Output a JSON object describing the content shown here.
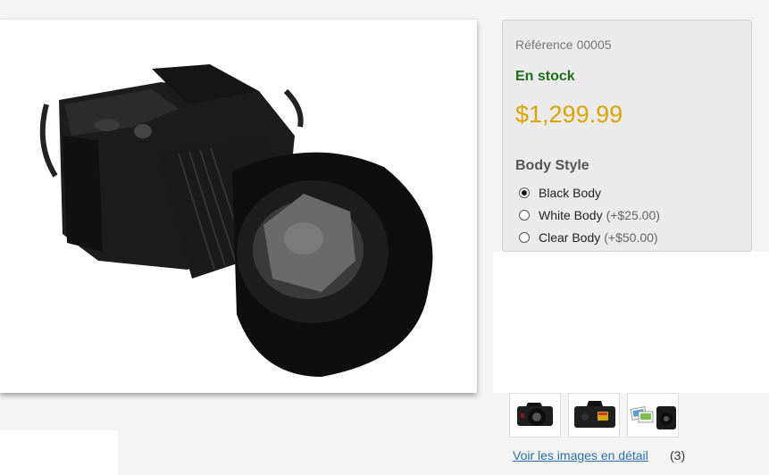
{
  "product": {
    "reference_label": "Référence",
    "reference_value": "00005",
    "stock_status": "En stock",
    "price": "$1,299.99",
    "image_alt": "DSLR camera with lens hood"
  },
  "options": {
    "title": "Body Style",
    "items": [
      {
        "label": "Black Body",
        "surcharge": "",
        "selected": true
      },
      {
        "label": "White Body",
        "surcharge": "(+$25.00)",
        "selected": false
      },
      {
        "label": "Clear Body",
        "surcharge": "(+$50.00)",
        "selected": false
      }
    ]
  },
  "gallery": {
    "thumbnails": [
      "camera-front-thumbnail",
      "camera-back-thumbnail",
      "camera-with-photos-thumbnail"
    ],
    "view_link": "Voir les images en détail",
    "count": "(3)"
  },
  "colors": {
    "stock": "#1b6e1b",
    "price": "#d9a400",
    "link": "#2a6ea6"
  }
}
